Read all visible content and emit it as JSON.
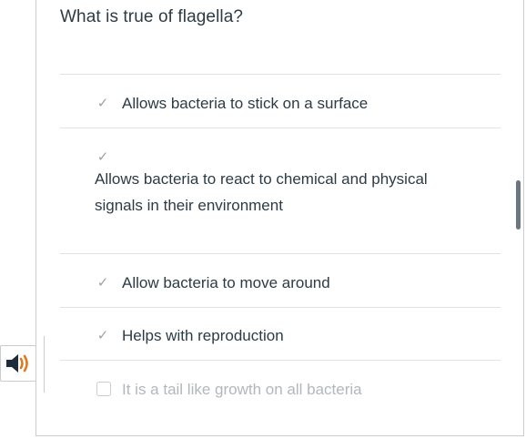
{
  "question": {
    "text": "What is true of flagella?"
  },
  "answers": [
    {
      "label": "Allows bacteria to stick on a surface",
      "checked": true,
      "enabled": true
    },
    {
      "label": "Allows bacteria to react to chemical and physical signals in their environment",
      "checked": true,
      "enabled": true
    },
    {
      "label": "Allow bacteria to move around",
      "checked": true,
      "enabled": true
    },
    {
      "label": "Helps with reproduction",
      "checked": true,
      "enabled": true
    },
    {
      "label": "It is a tail like growth on all bacteria",
      "checked": false,
      "enabled": false
    }
  ],
  "icons": {
    "check": "check-icon",
    "audio": "speaker-icon"
  },
  "colors": {
    "text": "#2d3b45",
    "disabled_text": "#b0b8bd",
    "divider": "#dfe3e6",
    "audio_speaker": "#1d2b3a",
    "audio_waves": "#e07a1f"
  }
}
